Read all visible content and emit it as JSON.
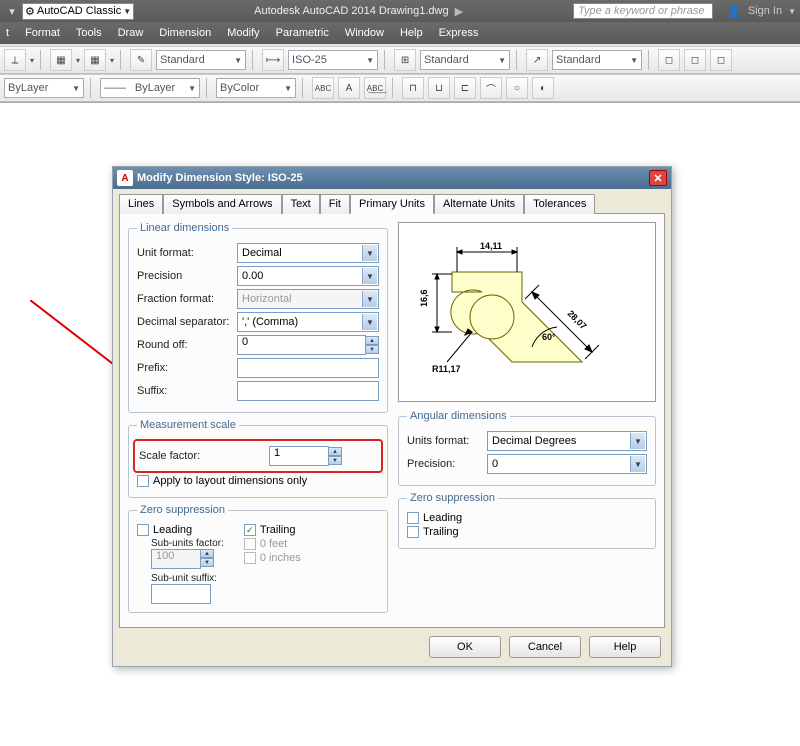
{
  "titlebar": {
    "workspace": "AutoCAD Classic",
    "app_title": "Autodesk AutoCAD 2014   Drawing1.dwg",
    "search_placeholder": "Type a keyword or phrase",
    "sign_in": "Sign In"
  },
  "menubar": [
    "t",
    "Format",
    "Tools",
    "Draw",
    "Dimension",
    "Modify",
    "Parametric",
    "Window",
    "Help",
    "Express"
  ],
  "toolbar": {
    "style1": "Standard",
    "style2": "ISO-25",
    "style3": "Standard",
    "style4": "Standard",
    "layer_bylayer": "ByLayer",
    "layer_bycolor": "ByColor"
  },
  "dialog": {
    "title": "Modify Dimension Style: ISO-25",
    "tabs": [
      "Lines",
      "Symbols and Arrows",
      "Text",
      "Fit",
      "Primary Units",
      "Alternate Units",
      "Tolerances"
    ],
    "linear_dims": {
      "legend": "Linear dimensions",
      "unit_format_label": "Unit format:",
      "unit_format": "Decimal",
      "precision_label": "Precision",
      "precision": "0.00",
      "fraction_label": "Fraction format:",
      "fraction": "Horizontal",
      "dec_sep_label": "Decimal separator:",
      "dec_sep": "',' (Comma)",
      "round_label": "Round off:",
      "round": "0",
      "prefix_label": "Prefix:",
      "prefix": "",
      "suffix_label": "Suffix:",
      "suffix": ""
    },
    "meas_scale": {
      "legend": "Measurement scale",
      "scale_label": "Scale factor:",
      "scale": "1",
      "apply_layout": "Apply to layout dimensions only"
    },
    "zero_sup": {
      "legend": "Zero suppression",
      "leading": "Leading",
      "trailing": "Trailing",
      "sub_factor_label": "Sub-units factor:",
      "sub_factor": "100",
      "sub_suffix_label": "Sub-unit suffix:",
      "sub_suffix": "",
      "feet": "0 feet",
      "inches": "0 inches"
    },
    "angular": {
      "legend": "Angular dimensions",
      "units_label": "Units format:",
      "units": "Decimal Degrees",
      "precision_label": "Precision:",
      "precision": "0"
    },
    "zero_sup2": {
      "legend": "Zero suppression",
      "leading": "Leading",
      "trailing": "Trailing"
    },
    "preview_dims": {
      "top": "14,11",
      "left": "16,6",
      "right": "28,07",
      "angle": "60°",
      "radius": "R11,17"
    },
    "buttons": {
      "ok": "OK",
      "cancel": "Cancel",
      "help": "Help"
    }
  }
}
